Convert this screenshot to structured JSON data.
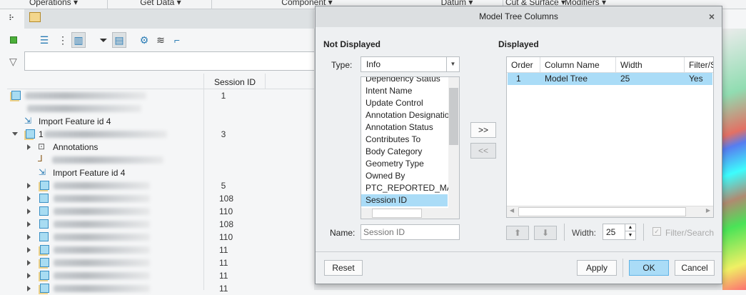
{
  "ribbon": {
    "menus": [
      "Operations ▾",
      "Get Data ▾",
      "Component ▾",
      "Datum ▾",
      "Cut & Surface ▾",
      "Modifiers ▾"
    ]
  },
  "tree": {
    "column_header": "Session ID",
    "rows": [
      {
        "label": "",
        "session_id": "1"
      },
      {
        "label": "",
        "session_id": ""
      },
      {
        "label": "Import Feature id 4",
        "session_id": ""
      },
      {
        "label": "1",
        "session_id": "3"
      },
      {
        "label": "Annotations",
        "session_id": ""
      },
      {
        "label": "",
        "session_id": ""
      },
      {
        "label": "Import Feature id 4",
        "session_id": ""
      },
      {
        "label": "",
        "session_id": "5"
      },
      {
        "label": "",
        "session_id": "108"
      },
      {
        "label": "",
        "session_id": "110"
      },
      {
        "label": "",
        "session_id": "108"
      },
      {
        "label": "",
        "session_id": "110"
      },
      {
        "label": "",
        "session_id": "11"
      },
      {
        "label": "",
        "session_id": "11"
      },
      {
        "label": "",
        "session_id": "11"
      },
      {
        "label": "",
        "session_id": "11"
      }
    ]
  },
  "dialog": {
    "title": "Model Tree Columns",
    "close": "×",
    "not_displayed": {
      "heading": "Not Displayed",
      "type_label": "Type:",
      "type_value": "Info",
      "items": [
        "Dependency Status",
        "Intent Name",
        "Update Control",
        "Annotation Designatio",
        "Annotation Status",
        "Contributes To",
        "Body Category",
        "Geometry Type",
        "Owned By",
        "PTC_REPORTED_MATE",
        "Session ID"
      ],
      "selected": "Session ID",
      "name_label": "Name:",
      "name_placeholder": "Session ID"
    },
    "add_label": ">>",
    "remove_label": "<<",
    "displayed": {
      "heading": "Displayed",
      "columns": [
        "Order",
        "Column Name",
        "Width",
        "Filter/Search"
      ],
      "rows": [
        {
          "order": "1",
          "name": "Model Tree",
          "width": "25",
          "filter": "Yes"
        }
      ],
      "width_label": "Width:",
      "width_value": "25",
      "filter_label": "Filter/Search"
    },
    "buttons": {
      "reset": "Reset",
      "apply": "Apply",
      "ok": "OK",
      "cancel": "Cancel"
    }
  }
}
